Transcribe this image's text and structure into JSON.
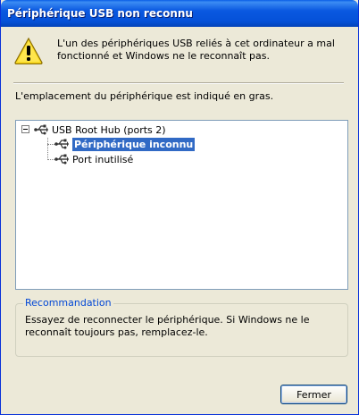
{
  "window": {
    "title": "Périphérique USB non reconnu"
  },
  "header": {
    "icon": "warning-icon",
    "message": "L'un des périphériques USB reliés à cet ordinateur a mal fonctionné et Windows ne le reconnaît pas."
  },
  "location_text": "L'emplacement du périphérique est indiqué en gras.",
  "tree": {
    "root": {
      "label": "USB Root Hub (ports 2)",
      "icon": "usb-icon",
      "expanded": true
    },
    "children": [
      {
        "label": "Périphérique inconnu",
        "icon": "usb-icon",
        "selected": true,
        "bold": true
      },
      {
        "label": "Port inutilisé",
        "icon": "usb-icon",
        "selected": false,
        "bold": false
      }
    ]
  },
  "recommendation": {
    "title": "Recommandation",
    "text": "Essayez de reconnecter le périphérique. Si Windows ne le reconnaît toujours pas, remplacez-le."
  },
  "buttons": {
    "close_label": "Fermer"
  },
  "colors": {
    "titlebar": "#0551d8",
    "dialog_bg": "#ece9d8",
    "selection": "#316ac5",
    "group_title": "#0046d5"
  }
}
